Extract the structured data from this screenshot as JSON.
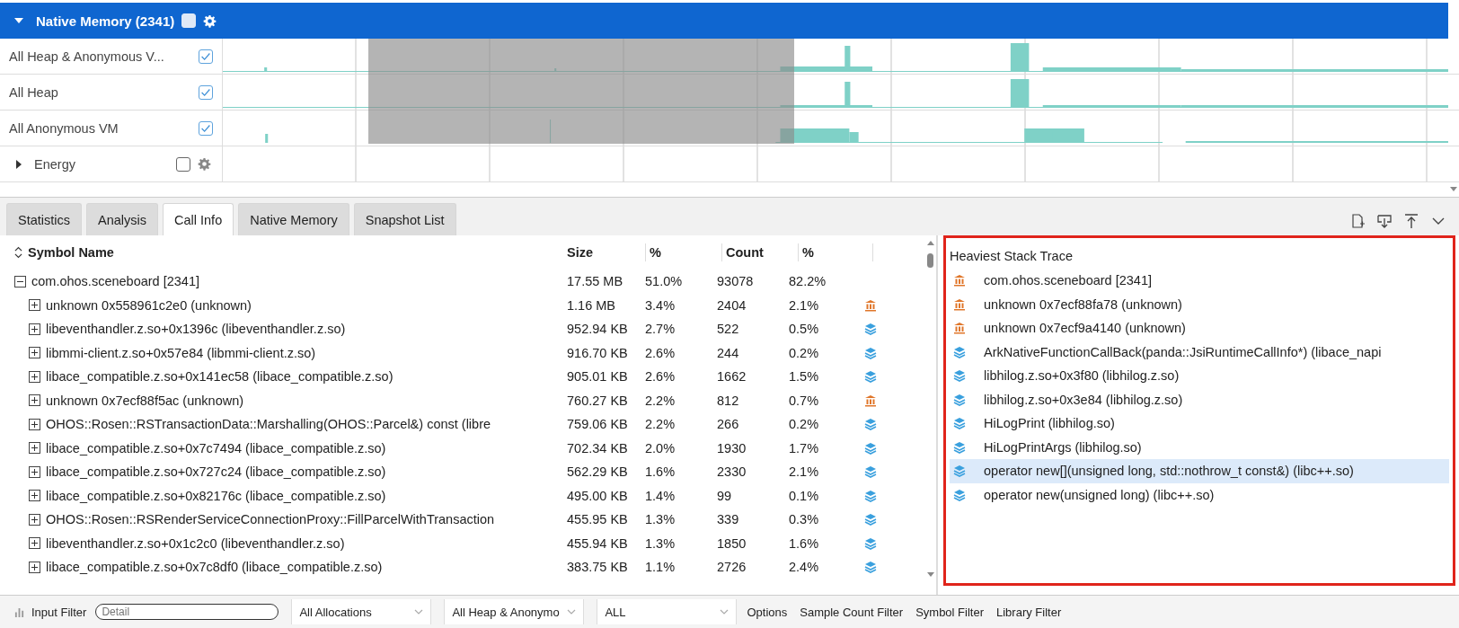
{
  "group": {
    "title": "Native Memory (2341)",
    "expanded": true,
    "checked": false
  },
  "tracks": [
    {
      "kind": "chart",
      "label": "All Heap & Anonymous V...",
      "checked": true
    },
    {
      "kind": "chart",
      "label": "All Heap",
      "checked": true
    },
    {
      "kind": "chart",
      "label": "All Anonymous VM",
      "checked": true
    },
    {
      "kind": "folder",
      "label": "Energy",
      "checked": false,
      "expanded": false
    }
  ],
  "tabs": [
    {
      "label": "Statistics",
      "selected": false
    },
    {
      "label": "Analysis",
      "selected": false
    },
    {
      "label": "Call Info",
      "selected": true
    },
    {
      "label": "Native Memory",
      "selected": false
    },
    {
      "label": "Snapshot List",
      "selected": false
    }
  ],
  "table": {
    "columns": [
      "Symbol Name",
      "Size",
      "%",
      "Count",
      "%"
    ],
    "rows": [
      {
        "name": "com.ohos.sceneboard [2341]",
        "size": "17.55 MB",
        "size_pct": "51.0%",
        "count": "93078",
        "count_pct": "82.2%",
        "expanded": true,
        "children": [
          {
            "kind": "unknown",
            "name": "unknown 0x558961c2e0 (unknown)",
            "size": "1.16 MB",
            "size_pct": "3.4%",
            "count": "2404",
            "count_pct": "2.1%",
            "expanded": false
          },
          {
            "kind": "library",
            "name": "libeventhandler.z.so+0x1396c (libeventhandler.z.so)",
            "size": "952.94 KB",
            "size_pct": "2.7%",
            "count": "522",
            "count_pct": "0.5%",
            "expanded": false
          },
          {
            "kind": "library",
            "name": "libmmi-client.z.so+0x57e84 (libmmi-client.z.so)",
            "size": "916.70 KB",
            "size_pct": "2.6%",
            "count": "244",
            "count_pct": "0.2%",
            "expanded": false
          },
          {
            "kind": "library",
            "name": "libace_compatible.z.so+0x141ec58 (libace_compatible.z.so)",
            "size": "905.01 KB",
            "size_pct": "2.6%",
            "count": "1662",
            "count_pct": "1.5%",
            "expanded": false
          },
          {
            "kind": "unknown",
            "name": "unknown 0x7ecf88f5ac (unknown)",
            "size": "760.27 KB",
            "size_pct": "2.2%",
            "count": "812",
            "count_pct": "0.7%",
            "expanded": false
          },
          {
            "kind": "library",
            "name": "OHOS::Rosen::RSTransactionData::Marshalling(OHOS::Parcel&) const (libre",
            "size": "759.06 KB",
            "size_pct": "2.2%",
            "count": "266",
            "count_pct": "0.2%",
            "expanded": false
          },
          {
            "kind": "library",
            "name": "libace_compatible.z.so+0x7c7494 (libace_compatible.z.so)",
            "size": "702.34 KB",
            "size_pct": "2.0%",
            "count": "1930",
            "count_pct": "1.7%",
            "expanded": false
          },
          {
            "kind": "library",
            "name": "libace_compatible.z.so+0x727c24 (libace_compatible.z.so)",
            "size": "562.29 KB",
            "size_pct": "1.6%",
            "count": "2330",
            "count_pct": "2.1%",
            "expanded": false
          },
          {
            "kind": "library",
            "name": "libace_compatible.z.so+0x82176c (libace_compatible.z.so)",
            "size": "495.00 KB",
            "size_pct": "1.4%",
            "count": "99",
            "count_pct": "0.1%",
            "expanded": false
          },
          {
            "kind": "library",
            "name": "OHOS::Rosen::RSRenderServiceConnectionProxy::FillParcelWithTransaction",
            "size": "455.95 KB",
            "size_pct": "1.3%",
            "count": "339",
            "count_pct": "0.3%",
            "expanded": false
          },
          {
            "kind": "library",
            "name": "libeventhandler.z.so+0x1c2c0 (libeventhandler.z.so)",
            "size": "455.94 KB",
            "size_pct": "1.3%",
            "count": "1850",
            "count_pct": "1.6%",
            "expanded": false
          },
          {
            "kind": "library",
            "name": "libace_compatible.z.so+0x7c8df0 (libace_compatible.z.so)",
            "size": "383.75 KB",
            "size_pct": "1.1%",
            "count": "2726",
            "count_pct": "2.4%",
            "expanded": false
          }
        ]
      }
    ]
  },
  "stack": {
    "title": "Heaviest Stack Trace",
    "items": [
      {
        "kind": "unknown",
        "text": "com.ohos.sceneboard [2341]",
        "selected": false
      },
      {
        "kind": "unknown",
        "text": "unknown 0x7ecf88fa78 (unknown)",
        "selected": false
      },
      {
        "kind": "unknown",
        "text": "unknown 0x7ecf9a4140 (unknown)",
        "selected": false
      },
      {
        "kind": "library",
        "text": "ArkNativeFunctionCallBack(panda::JsiRuntimeCallInfo*) (libace_napi",
        "selected": false
      },
      {
        "kind": "library",
        "text": "libhilog.z.so+0x3f80 (libhilog.z.so)",
        "selected": false
      },
      {
        "kind": "library",
        "text": "libhilog.z.so+0x3e84 (libhilog.z.so)",
        "selected": false
      },
      {
        "kind": "library",
        "text": "HiLogPrint (libhilog.so)",
        "selected": false
      },
      {
        "kind": "library",
        "text": "HiLogPrintArgs (libhilog.so)",
        "selected": false
      },
      {
        "kind": "library",
        "text": "operator new[](unsigned long, std::nothrow_t const&) (libc++.so)",
        "selected": true
      },
      {
        "kind": "library",
        "text": "operator new(unsigned long) (libc++.so)",
        "selected": false
      }
    ]
  },
  "filter_bar": {
    "label": "Input Filter",
    "placeholder": "Detail",
    "selects": [
      "All Allocations",
      "All Heap & Anonymo",
      "ALL"
    ],
    "links": [
      "Options",
      "Sample Count Filter",
      "Symbol Filter",
      "Library Filter"
    ]
  }
}
